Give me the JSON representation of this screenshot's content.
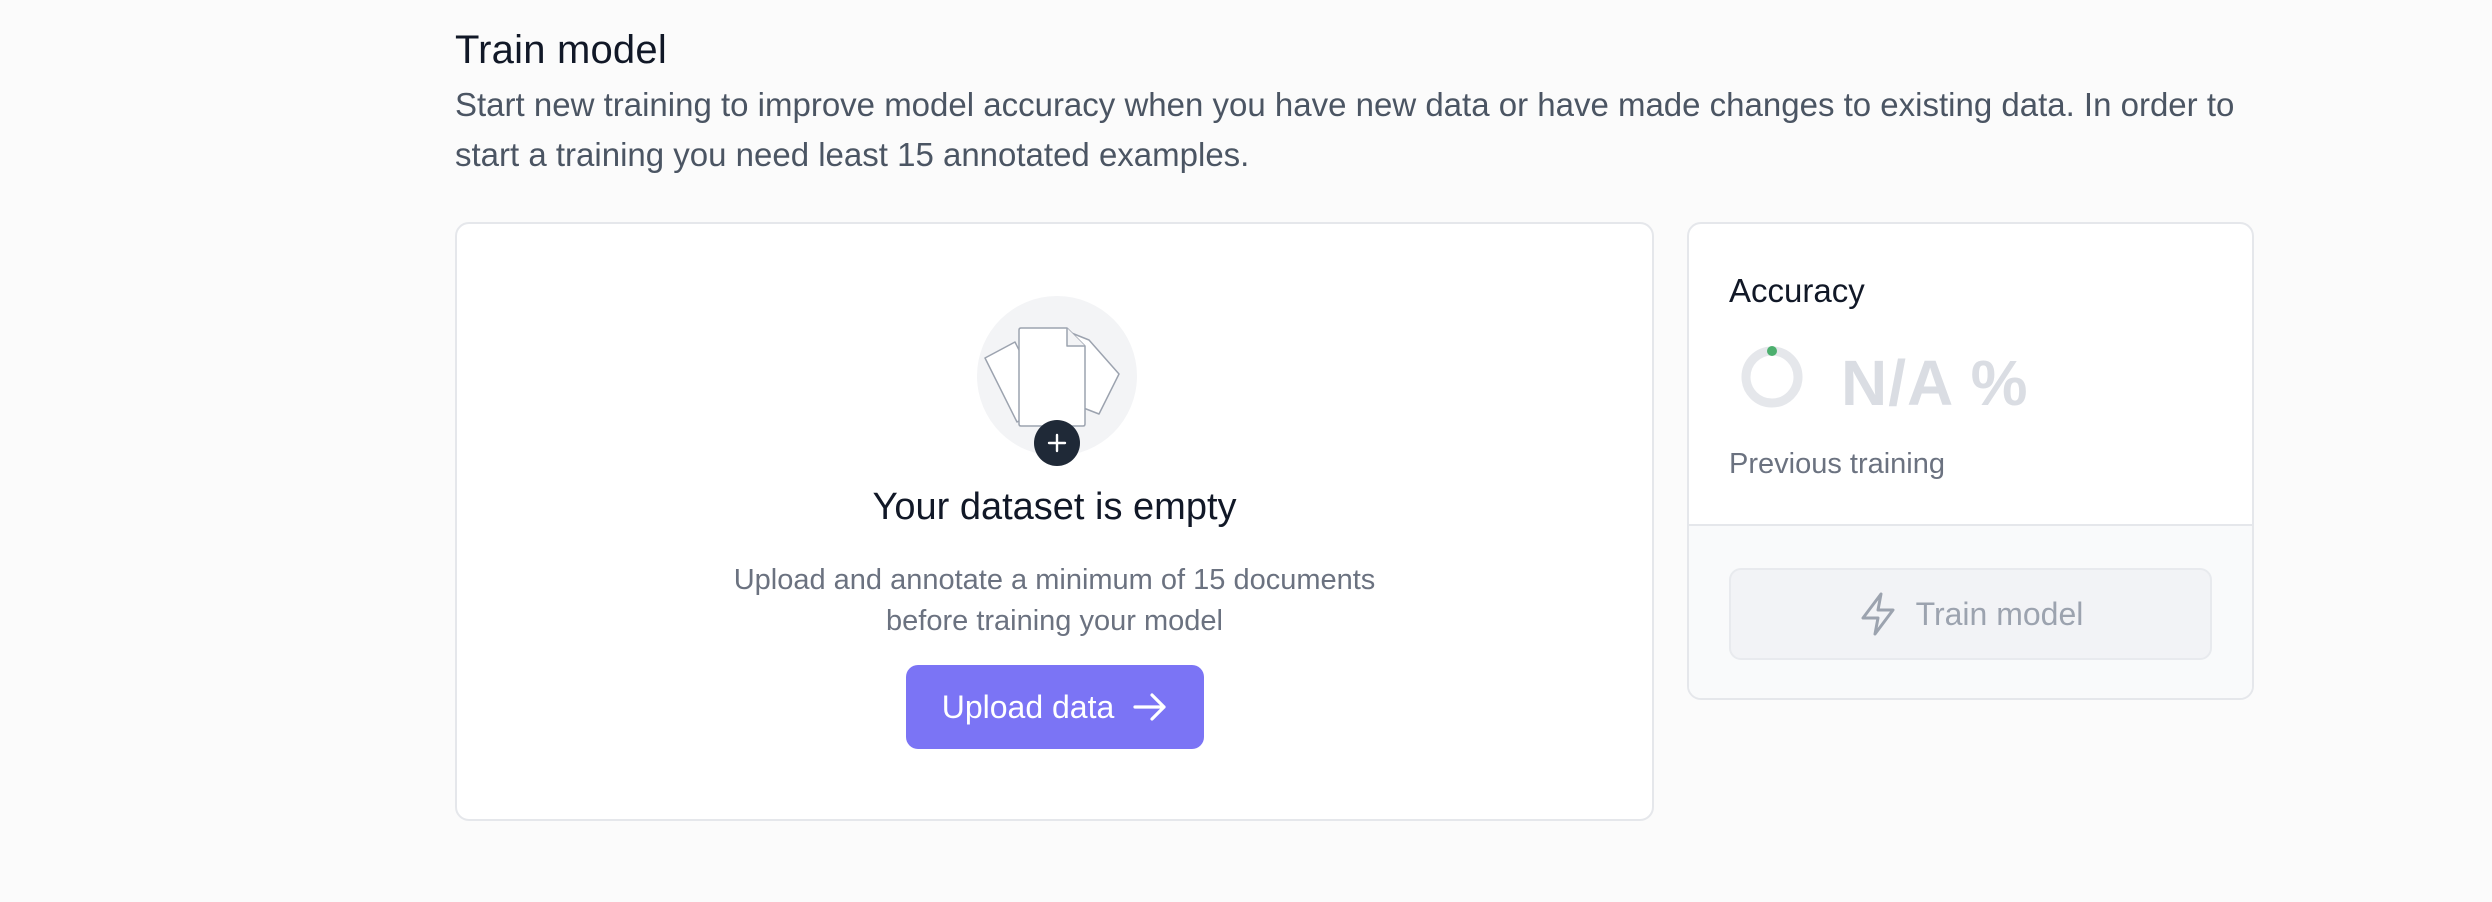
{
  "header": {
    "title": "Train model",
    "description": "Start new training to improve model accuracy when you have new data or have made changes to existing data. In order to start a training you need least 15 annotated examples."
  },
  "dataset": {
    "illustration_icon": "documents-icon",
    "badge_icon": "plus-icon",
    "empty_title": "Your dataset is empty",
    "empty_description": "Upload and annotate a minimum of 15 documents before training your model",
    "upload_label": "Upload data",
    "upload_icon": "arrow-right-icon",
    "accent_color": "#7b74f5"
  },
  "accuracy": {
    "title": "Accuracy",
    "value": "N/A %",
    "status_color": "#4caf6e",
    "previous_label": "Previous training",
    "train_label": "Train model",
    "train_icon": "lightning-icon",
    "train_disabled": true
  }
}
